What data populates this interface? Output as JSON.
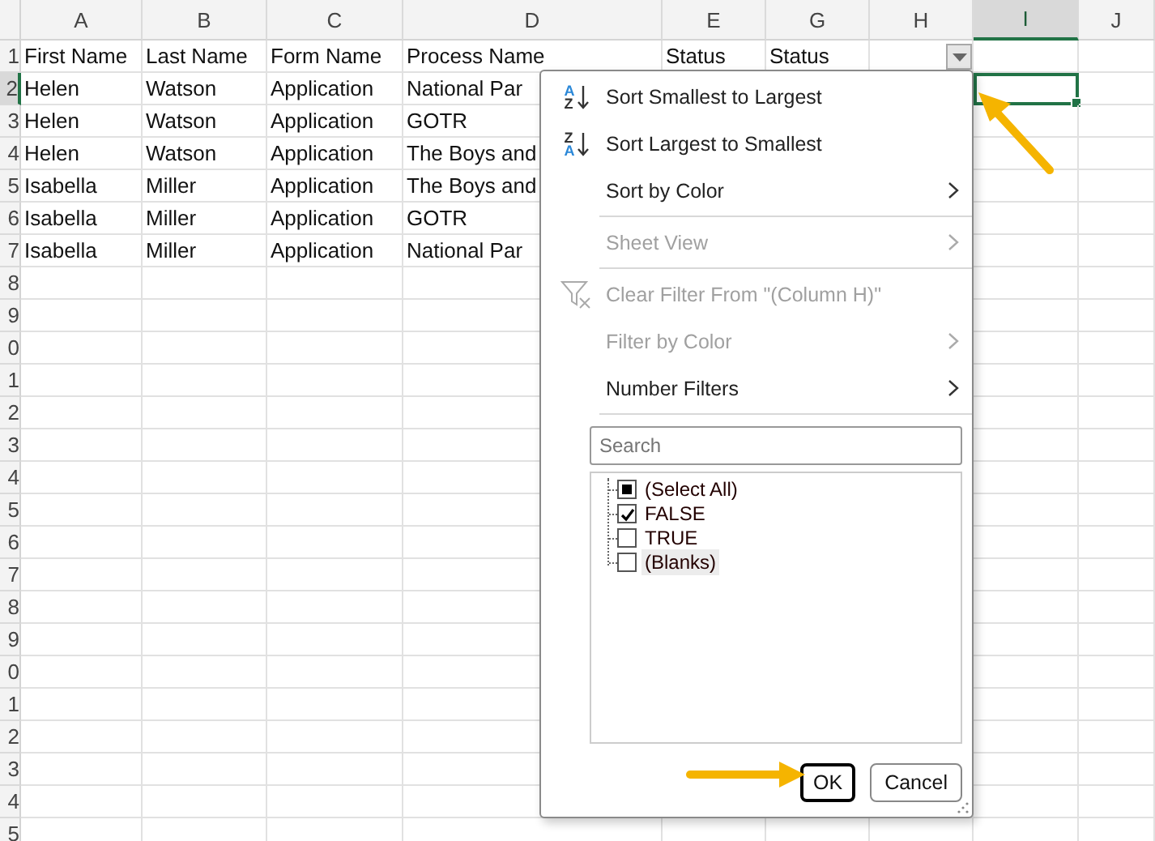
{
  "columns": [
    {
      "label": "A",
      "selected": false,
      "filter_button": false
    },
    {
      "label": "B",
      "selected": false,
      "filter_button": false
    },
    {
      "label": "C",
      "selected": false,
      "filter_button": false
    },
    {
      "label": "D",
      "selected": false,
      "filter_button": false
    },
    {
      "label": "E",
      "selected": false,
      "filter_button": false
    },
    {
      "label": "G",
      "selected": false,
      "filter_button": false
    },
    {
      "label": "H",
      "selected": false,
      "filter_button": true
    },
    {
      "label": "I",
      "selected": true,
      "filter_button": false
    },
    {
      "label": "J",
      "selected": false,
      "filter_button": false
    }
  ],
  "rows": [
    {
      "header": "1",
      "selected": false,
      "cells": [
        "First Name",
        "Last Name",
        "Form Name",
        "Process Name",
        "Status",
        "Status"
      ]
    },
    {
      "header": "2",
      "selected": true,
      "cells": [
        "Helen",
        "Watson",
        "Application",
        "National Par"
      ]
    },
    {
      "header": "3",
      "selected": false,
      "cells": [
        "Helen",
        "Watson",
        "Application",
        "GOTR"
      ]
    },
    {
      "header": "4",
      "selected": false,
      "cells": [
        "Helen",
        "Watson",
        "Application",
        "The Boys and"
      ]
    },
    {
      "header": "5",
      "selected": false,
      "cells": [
        "Isabella",
        "Miller",
        "Application",
        "The Boys and"
      ]
    },
    {
      "header": "6",
      "selected": false,
      "cells": [
        "Isabella",
        "Miller",
        "Application",
        "GOTR"
      ]
    },
    {
      "header": "7",
      "selected": false,
      "cells": [
        "Isabella",
        "Miller",
        "Application",
        "National Par"
      ]
    },
    {
      "header": "8",
      "selected": false,
      "cells": []
    },
    {
      "header": "9",
      "selected": false,
      "cells": []
    },
    {
      "header": "0",
      "selected": false,
      "cells": []
    },
    {
      "header": "1",
      "selected": false,
      "cells": []
    },
    {
      "header": "2",
      "selected": false,
      "cells": []
    },
    {
      "header": "3",
      "selected": false,
      "cells": []
    },
    {
      "header": "4",
      "selected": false,
      "cells": []
    },
    {
      "header": "5",
      "selected": false,
      "cells": []
    },
    {
      "header": "6",
      "selected": false,
      "cells": []
    },
    {
      "header": "7",
      "selected": false,
      "cells": []
    },
    {
      "header": "8",
      "selected": false,
      "cells": []
    },
    {
      "header": "9",
      "selected": false,
      "cells": []
    },
    {
      "header": "0",
      "selected": false,
      "cells": []
    },
    {
      "header": "1",
      "selected": false,
      "cells": []
    },
    {
      "header": "2",
      "selected": false,
      "cells": []
    },
    {
      "header": "3",
      "selected": false,
      "cells": []
    },
    {
      "header": "4",
      "selected": false,
      "cells": []
    },
    {
      "header": "5",
      "selected": false,
      "cells": []
    }
  ],
  "filter_menu": {
    "items": [
      {
        "kind": "sort",
        "icon_letters": [
          "A",
          "Z"
        ],
        "label": "Sort Smallest to Largest",
        "disabled": false,
        "submenu": false
      },
      {
        "kind": "sort",
        "icon_letters": [
          "Z",
          "A"
        ],
        "label": "Sort Largest to Smallest",
        "disabled": false,
        "submenu": false
      },
      {
        "kind": "plain",
        "label": "Sort by Color",
        "disabled": false,
        "submenu": true
      },
      {
        "kind": "separator"
      },
      {
        "kind": "plain",
        "label": "Sheet View",
        "disabled": true,
        "submenu": true
      },
      {
        "kind": "separator"
      },
      {
        "kind": "clear",
        "label": "Clear Filter From \"(Column H)\"",
        "disabled": true,
        "submenu": false
      },
      {
        "kind": "plain",
        "label": "Filter by Color",
        "disabled": true,
        "submenu": true
      },
      {
        "kind": "plain",
        "label": "Number Filters",
        "disabled": false,
        "submenu": true
      },
      {
        "kind": "separator"
      }
    ],
    "search": {
      "placeholder": "Search"
    },
    "values": [
      {
        "label": "(Select All)",
        "checked": false,
        "partial": true,
        "highlighted": false
      },
      {
        "label": "FALSE",
        "checked": true,
        "partial": false,
        "highlighted": false
      },
      {
        "label": "TRUE",
        "checked": false,
        "partial": false,
        "highlighted": false
      },
      {
        "label": "(Blanks)",
        "checked": false,
        "partial": false,
        "highlighted": true
      }
    ],
    "buttons": [
      {
        "label": "OK",
        "default": true
      },
      {
        "label": "Cancel",
        "default": false
      }
    ]
  }
}
